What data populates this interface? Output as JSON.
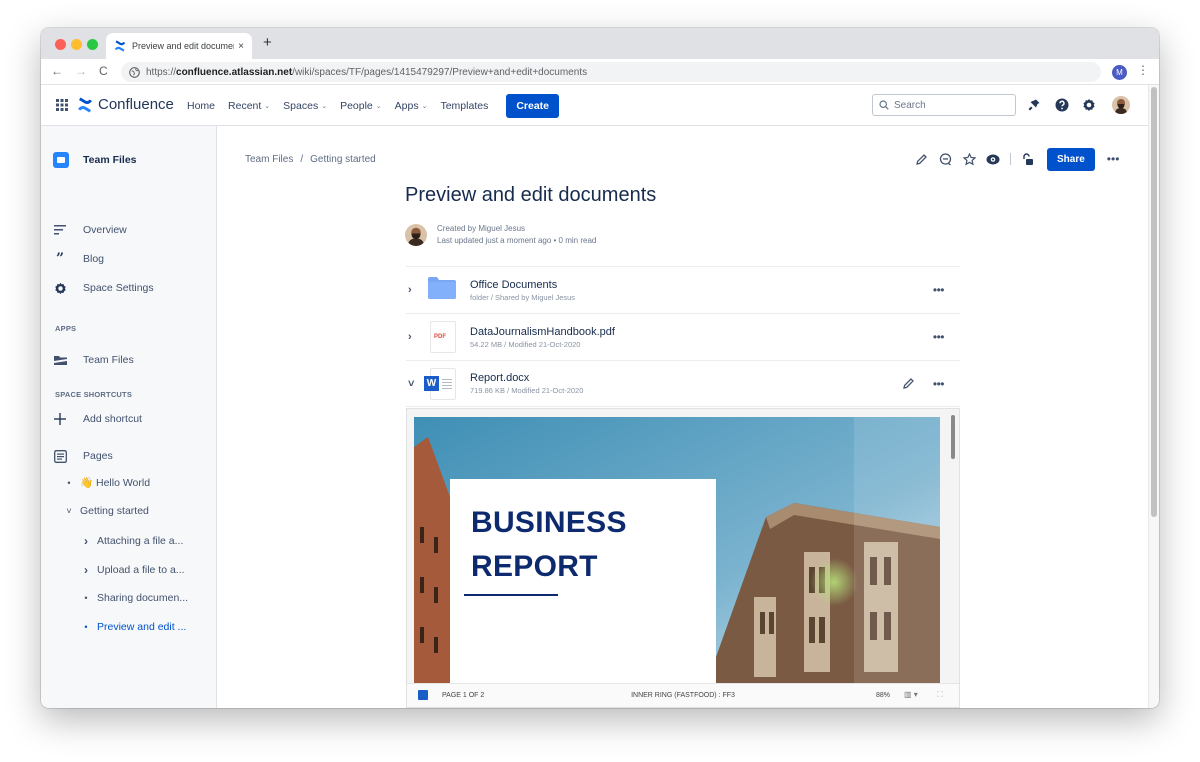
{
  "browser": {
    "tab_title": "Preview and edit documents - ",
    "tab_close": "×",
    "new_tab": "+",
    "url_scheme": "https://",
    "url_host": "confluence.atlassian.net",
    "url_path": "/wiki/spaces/TF/pages/1415479297/Preview+and+edit+documents",
    "profile_initial": "M",
    "back": "←",
    "forward": "→",
    "reload": "C",
    "menu": "⋮"
  },
  "topnav": {
    "product": "Confluence",
    "links": [
      {
        "label": "Home",
        "dropdown": false
      },
      {
        "label": "Recent",
        "dropdown": true
      },
      {
        "label": "Spaces",
        "dropdown": true
      },
      {
        "label": "People",
        "dropdown": true
      },
      {
        "label": "Apps",
        "dropdown": true
      },
      {
        "label": "Templates",
        "dropdown": false
      }
    ],
    "caret": "⌄",
    "create_label": "Create",
    "search_placeholder": "Search"
  },
  "sidebar": {
    "space_name": "Team Files",
    "items": [
      {
        "label": "Overview",
        "icon": "overview-icon"
      },
      {
        "label": "Blog",
        "icon": "quote-icon"
      },
      {
        "label": "Space Settings",
        "icon": "gear-icon"
      }
    ],
    "apps_heading": "APPS",
    "apps": [
      {
        "label": "Team Files",
        "icon": "files-app-icon"
      }
    ],
    "shortcuts_heading": "SPACE SHORTCUTS",
    "add_shortcut": "Add shortcut",
    "pages_label": "Pages",
    "tree": [
      {
        "label": "👋 Hello World",
        "marker": "•",
        "level": 1
      },
      {
        "label": "Getting started",
        "marker": "˅",
        "level": 1
      },
      {
        "label": "Attaching a file a...",
        "marker": "›",
        "level": 2
      },
      {
        "label": "Upload a file to a...",
        "marker": "›",
        "level": 2
      },
      {
        "label": "Sharing documen...",
        "marker": "•",
        "level": 2
      },
      {
        "label": "Preview and edit ...",
        "marker": "•",
        "level": 2,
        "active": true
      }
    ]
  },
  "content": {
    "breadcrumb": [
      "Team Files",
      "Getting started"
    ],
    "breadcrumb_sep": "/",
    "share_label": "Share",
    "more": "•••",
    "title": "Preview and edit documents",
    "created_by": "Created by Miguel Jesus",
    "last_updated": "Last updated just a moment ago",
    "read_time": "0 min read",
    "dot": " • ",
    "files": [
      {
        "name": "Office Documents",
        "meta": "folder / Shared by Miguel Jesus",
        "type": "folder",
        "expanded": false
      },
      {
        "name": "DataJournalismHandbook.pdf",
        "meta": "54.22 MB / Modified 21-Oct-2020",
        "type": "pdf",
        "expanded": false
      },
      {
        "name": "Report.docx",
        "meta": "719.86 KB / Modified 21-Oct-2020",
        "type": "docx",
        "expanded": true
      }
    ],
    "pdf_badge": "PDF",
    "word_badge": "W",
    "chev_collapsed": "›",
    "chev_expanded": "˅"
  },
  "preview": {
    "heading_line1": "BUSINESS",
    "heading_line2": "REPORT",
    "page_status": "PAGE 1 OF 2",
    "doc_info": "INNER RING (FASTFOOD) : FF3",
    "zoom": "88%",
    "layout_toggle": "▥ ▾",
    "fullscreen": "⛶"
  },
  "colors": {
    "brand_blue": "#0052cc",
    "text_primary": "#172b4d",
    "report_navy": "#0e2a6e"
  }
}
